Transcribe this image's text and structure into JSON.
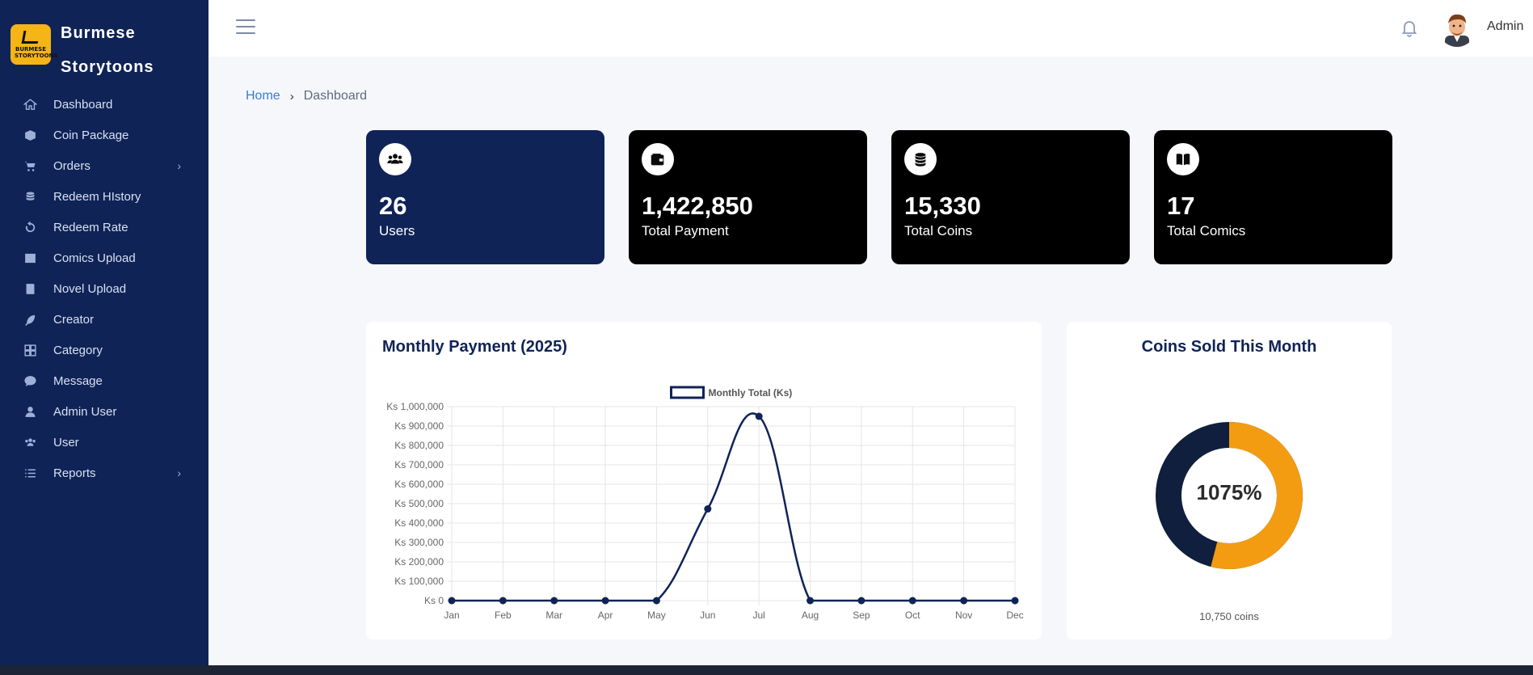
{
  "brand": {
    "name_line1": "Burmese",
    "name_line2": "Storytoons",
    "logo_text": "BURMESE STORYTOONS"
  },
  "sidebar": {
    "items": [
      {
        "label": "Dashboard",
        "icon": "home-icon",
        "has_submenu": false
      },
      {
        "label": "Coin Package",
        "icon": "box-icon",
        "has_submenu": false
      },
      {
        "label": "Orders",
        "icon": "cart-icon",
        "has_submenu": true
      },
      {
        "label": "Redeem HIstory",
        "icon": "coins-stack-icon",
        "has_submenu": false
      },
      {
        "label": "Redeem Rate",
        "icon": "rotate-icon",
        "has_submenu": false
      },
      {
        "label": "Comics Upload",
        "icon": "image-icon",
        "has_submenu": false
      },
      {
        "label": "Novel Upload",
        "icon": "book-icon",
        "has_submenu": false
      },
      {
        "label": "Creator",
        "icon": "feather-icon",
        "has_submenu": false
      },
      {
        "label": "Category",
        "icon": "grid-icon",
        "has_submenu": false
      },
      {
        "label": "Message",
        "icon": "chat-icon",
        "has_submenu": false
      },
      {
        "label": "Admin User",
        "icon": "user-icon",
        "has_submenu": false
      },
      {
        "label": "User",
        "icon": "users-icon",
        "has_submenu": false
      },
      {
        "label": "Reports",
        "icon": "list-icon",
        "has_submenu": true
      }
    ],
    "chevron": "›"
  },
  "header": {
    "user_name": "Admin",
    "bell_icon": "bell-icon",
    "menu_icon": "hamburger-icon"
  },
  "breadcrumb": {
    "home": "Home",
    "separator": "›",
    "current": "Dashboard"
  },
  "stats": [
    {
      "value": "26",
      "label": "Users",
      "icon": "users-icon"
    },
    {
      "value": "1,422,850",
      "label": "Total Payment",
      "icon": "wallet-icon"
    },
    {
      "value": "15,330",
      "label": "Total Coins",
      "icon": "coins-icon"
    },
    {
      "value": "17",
      "label": "Total Comics",
      "icon": "book-open-icon"
    }
  ],
  "monthly_chart": {
    "title": "Monthly Payment (2025)"
  },
  "donut": {
    "title": "Coins Sold This Month",
    "percent_label": "1075%",
    "footer": "10,750 coins",
    "colors": {
      "filled": "#f39c12",
      "remaining": "#0f1f3d"
    },
    "filled_fraction": 0.54
  },
  "chart_data": {
    "type": "line",
    "title": "Monthly Payment (2025)",
    "legend": "Monthly Total (Ks)",
    "legend_position": "top",
    "categories": [
      "Jan",
      "Feb",
      "Mar",
      "Apr",
      "May",
      "Jun",
      "Jul",
      "Aug",
      "Sep",
      "Oct",
      "Nov",
      "Dec"
    ],
    "series": [
      {
        "name": "Monthly Total (Ks)",
        "values": [
          0,
          0,
          0,
          0,
          0,
          472850,
          950000,
          0,
          0,
          0,
          0,
          0
        ],
        "color": "#0f2356"
      }
    ],
    "y_ticks": [
      "Ks 0",
      "Ks 100,000",
      "Ks 200,000",
      "Ks 300,000",
      "Ks 400,000",
      "Ks 500,000",
      "Ks 600,000",
      "Ks 700,000",
      "Ks 800,000",
      "Ks 900,000",
      "Ks 1,000,000"
    ],
    "ylim": [
      0,
      1000000
    ],
    "grid": true
  }
}
